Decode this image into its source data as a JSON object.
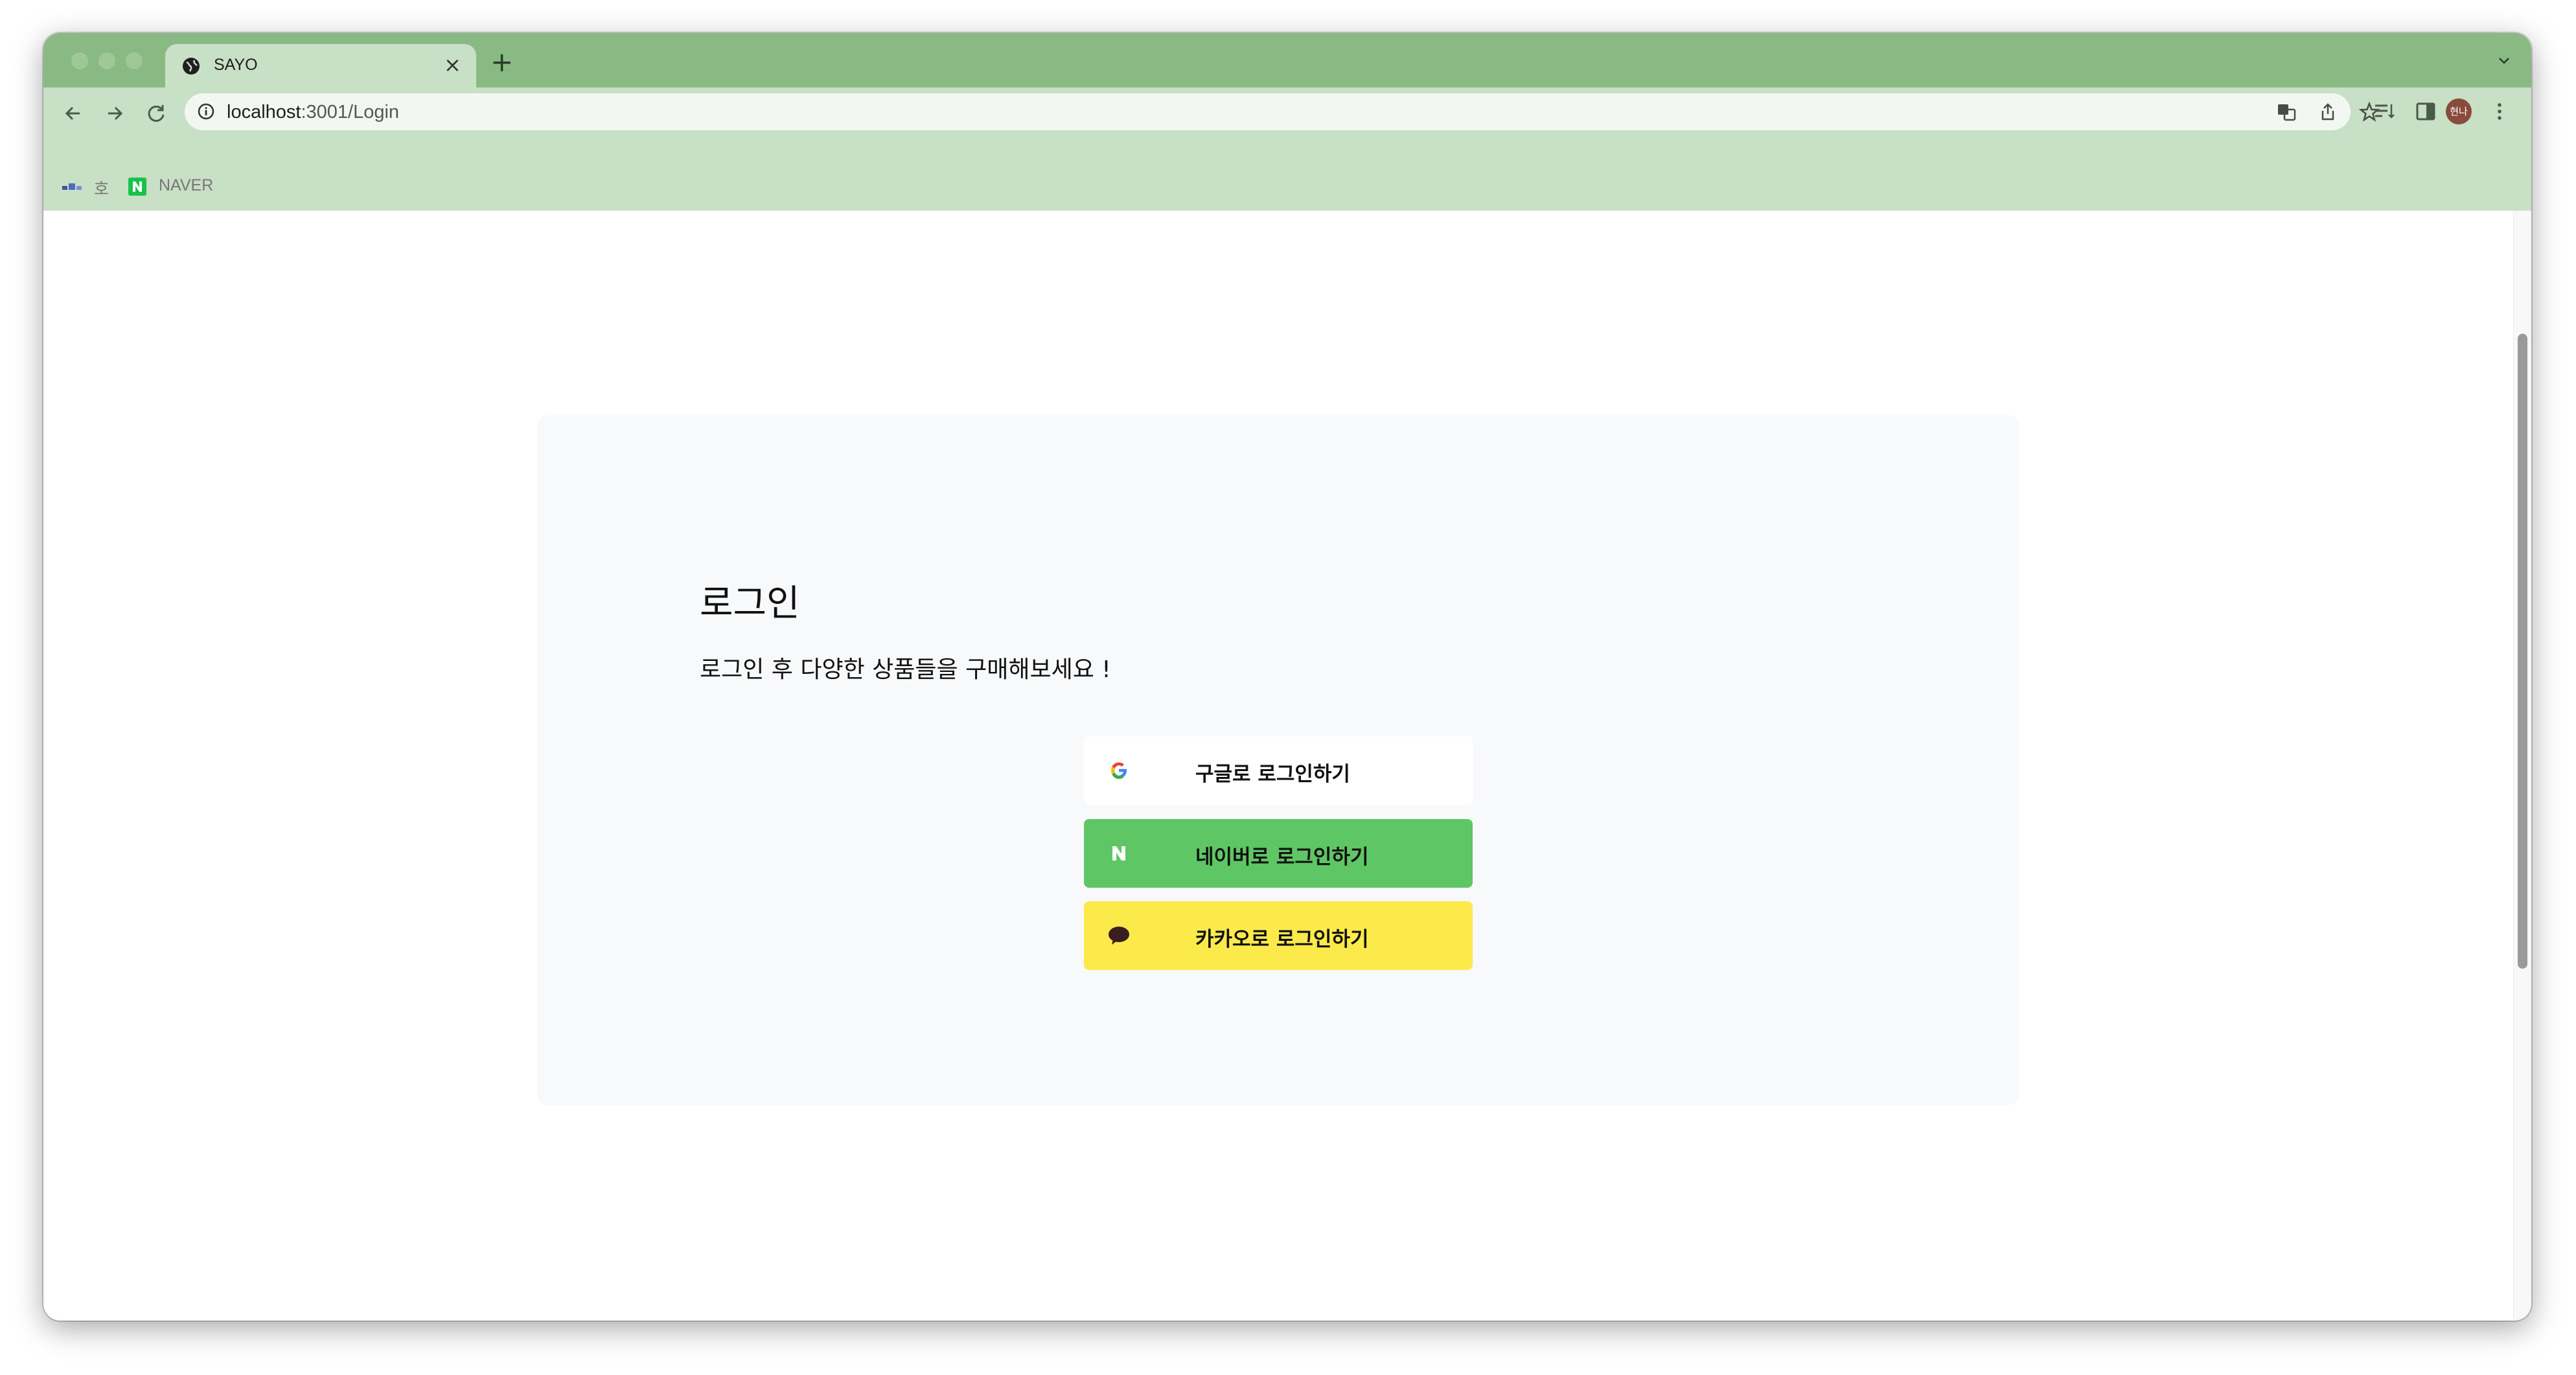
{
  "browser": {
    "tab_title": "SAYO",
    "tab_close": "×",
    "new_tab": "+",
    "url_host": "localhost",
    "url_path": ":3001/Login",
    "profile_initials": "현나",
    "bookmarks": [
      {
        "label": "호",
        "icon": "flag-icon"
      },
      {
        "label": "NAVER",
        "icon": "naver-icon"
      }
    ],
    "colors": {
      "frame": "#8aba83",
      "toolbar": "#c8e0c5"
    }
  },
  "login": {
    "title": "로그인",
    "subtitle": "로그인 후 다양한 상품들을 구매해보세요 !",
    "buttons": [
      {
        "label": "구글로 로그인하기",
        "icon": "google-icon",
        "color": "#ffffff"
      },
      {
        "label": "네이버로 로그인하기",
        "icon": "naver-n-icon",
        "color": "#5fc665"
      },
      {
        "label": "카카오로 로그인하기",
        "icon": "kakao-talk-icon",
        "color": "#fcea4a"
      }
    ]
  }
}
